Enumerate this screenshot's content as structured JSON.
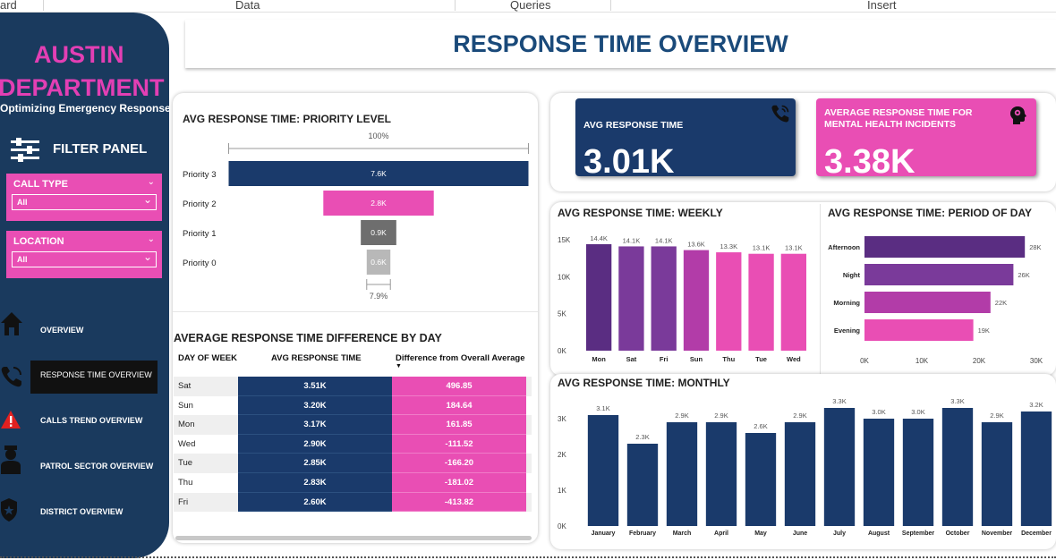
{
  "ribbon": {
    "tabs": [
      "ard",
      "Data",
      "Queries",
      "Insert"
    ]
  },
  "sidebar": {
    "brand_line1": "AUSTIN",
    "brand_line2": "DEPARTMENT",
    "brand_tagline": "Optimizing Emergency Response",
    "filter_title": "FILTER PANEL",
    "slicers": [
      {
        "label": "CALL TYPE",
        "value": "All"
      },
      {
        "label": "LOCATION",
        "value": "All"
      }
    ],
    "nav": [
      {
        "label": "OVERVIEW",
        "icon": "home-icon"
      },
      {
        "label": "RESPONSE TIME OVERVIEW",
        "icon": "phone-icon",
        "active": true
      },
      {
        "label": "CALLS TREND OVERVIEW",
        "icon": "warning-icon"
      },
      {
        "label": "PATROL SECTOR OVERVIEW",
        "icon": "officer-icon"
      },
      {
        "label": "DISTRICT OVERVIEW",
        "icon": "badge-icon"
      }
    ]
  },
  "page_title": "RESPONSE TIME OVERVIEW",
  "kpis": [
    {
      "label": "AVG RESPONSE TIME",
      "value": "3.01K",
      "color": "#1a3a6b",
      "icon": "phone-icon"
    },
    {
      "label": "AVERAGE RESPONSE TIME FOR MENTAL HEALTH INCIDENTS",
      "value": "3.38K",
      "color": "#e94eb4",
      "icon": "brain-head-icon"
    }
  ],
  "colors": {
    "navy": "#1a3a6b",
    "pink": "#e94eb4",
    "purple_dark": "#5a2d82",
    "purple_mid": "#7a3a9a",
    "magenta_mid": "#b23ca8",
    "grey_dark": "#6e6e6e",
    "grey_light": "#b8b8b8"
  },
  "chart_data": [
    {
      "type": "bar",
      "title": "AVG RESPONSE TIME: PRIORITY LEVEL",
      "orientation": "horizontal-funnel",
      "categories": [
        "Priority 3",
        "Priority 2",
        "Priority 1",
        "Priority 0"
      ],
      "values": [
        7600,
        2800,
        900,
        600
      ],
      "value_labels": [
        "7.6K",
        "2.8K",
        "0.9K",
        "0.6K"
      ],
      "top_label": "100%",
      "bottom_label": "7.9%"
    },
    {
      "type": "bar",
      "title": "AVG RESPONSE TIME: WEEKLY",
      "categories": [
        "Mon",
        "Sat",
        "Fri",
        "Sun",
        "Thu",
        "Tue",
        "Wed"
      ],
      "values": [
        14400,
        14100,
        14100,
        13600,
        13300,
        13100,
        13100
      ],
      "value_labels": [
        "14.4K",
        "14.1K",
        "14.1K",
        "13.6K",
        "13.3K",
        "13.1K",
        "13.1K"
      ],
      "ylim": [
        0,
        15000
      ],
      "yticks": [
        "0K",
        "5K",
        "10K",
        "15K"
      ],
      "grid": false
    },
    {
      "type": "bar",
      "title": "AVG RESPONSE TIME: PERIOD OF DAY",
      "orientation": "horizontal",
      "categories": [
        "Afternoon",
        "Night",
        "Morning",
        "Evening"
      ],
      "values": [
        28000,
        26000,
        22000,
        19000
      ],
      "value_labels": [
        "28K",
        "26K",
        "22K",
        "19K"
      ],
      "xlim": [
        0,
        30000
      ],
      "xticks": [
        "0K",
        "10K",
        "20K",
        "30K"
      ]
    },
    {
      "type": "bar",
      "title": "AVG RESPONSE TIME: MONTHLY",
      "categories": [
        "January",
        "February",
        "March",
        "April",
        "May",
        "June",
        "July",
        "August",
        "September",
        "October",
        "November",
        "December"
      ],
      "values": [
        3100,
        2300,
        2900,
        2900,
        2600,
        2900,
        3300,
        3000,
        3000,
        3300,
        2900,
        3200
      ],
      "value_labels": [
        "3.1K",
        "2.3K",
        "2.9K",
        "2.9K",
        "2.6K",
        "2.9K",
        "3.3K",
        "3.0K",
        "3.0K",
        "3.3K",
        "2.9K",
        "3.2K"
      ],
      "ylim": [
        0,
        3500
      ],
      "yticks": [
        "0K",
        "1K",
        "2K",
        "3K"
      ]
    },
    {
      "type": "table",
      "title": "AVERAGE RESPONSE TIME DIFFERENCE BY DAY",
      "columns": [
        "DAY OF WEEK",
        "AVG RESPONSE TIME",
        "Difference from Overall Average"
      ],
      "rows": [
        [
          "Sat",
          "3.51K",
          "496.85"
        ],
        [
          "Sun",
          "3.20K",
          "184.64"
        ],
        [
          "Mon",
          "3.17K",
          "161.85"
        ],
        [
          "Wed",
          "2.90K",
          "-111.52"
        ],
        [
          "Tue",
          "2.85K",
          "-166.20"
        ],
        [
          "Thu",
          "2.83K",
          "-181.02"
        ],
        [
          "Fri",
          "2.60K",
          "-413.82"
        ]
      ]
    }
  ]
}
